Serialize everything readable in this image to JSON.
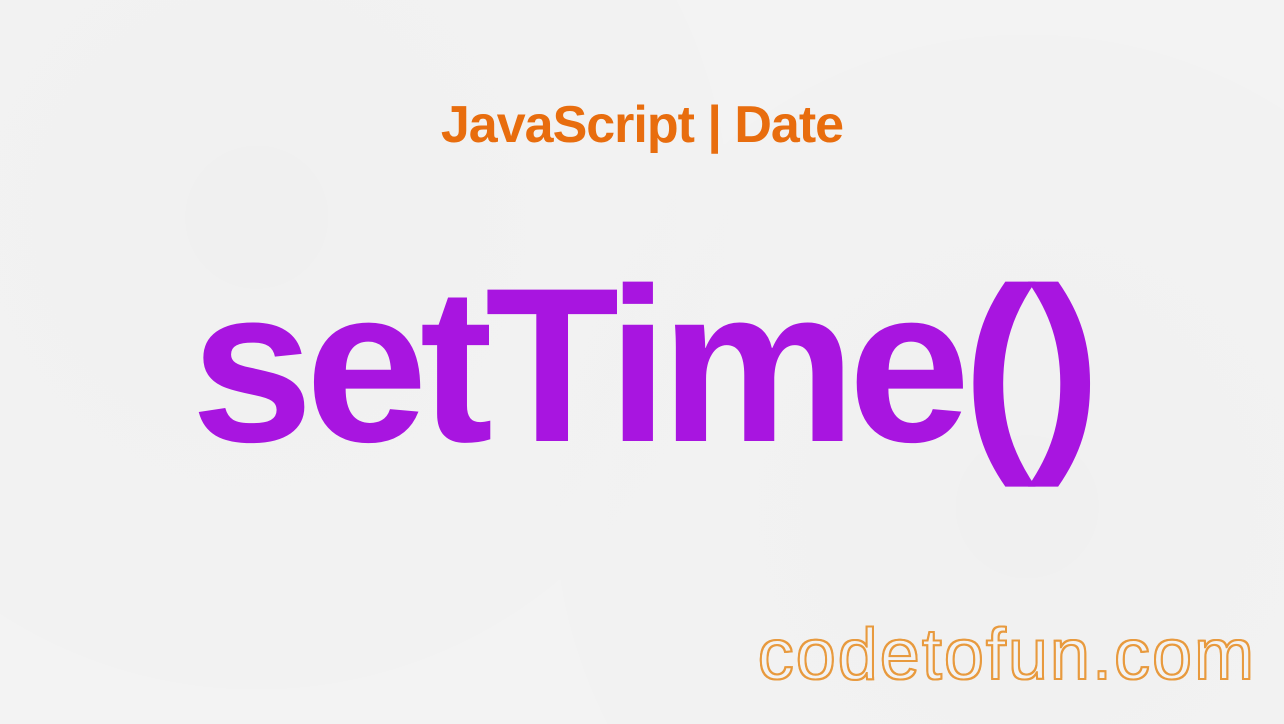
{
  "subtitle": "JavaScript | Date",
  "main_title": "setTime()",
  "watermark": "codetofun.com"
}
